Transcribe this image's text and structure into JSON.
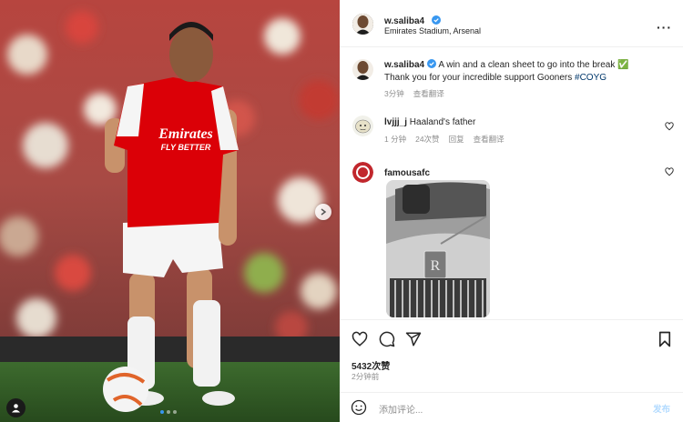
{
  "header": {
    "username": "w.saliba4",
    "location": "Emirates Stadium, Arsenal"
  },
  "caption": {
    "username": "w.saliba4",
    "text_line1": "A win and a clean sheet to go into the break ✅",
    "text_line2": "Thank you for your incredible support Gooners",
    "hashtag": "#COYG",
    "time": "3分钟",
    "translate": "查看翻译"
  },
  "comments": [
    {
      "username": "lvjjj_j",
      "text": "Haaland's father",
      "time": "1 分钟",
      "likes": "24次赞",
      "reply": "回复",
      "translate": "查看翻译"
    },
    {
      "username": "famousafc",
      "image_description": "Rolls-Royce grille"
    }
  ],
  "stats": {
    "likes": "5432次赞",
    "time": "2分钟前"
  },
  "comment_box": {
    "placeholder": "添加评论...",
    "post_label": "发布"
  },
  "photo": {
    "shirt_sponsor_line1": "Emirates",
    "shirt_sponsor_line2": "FLY BETTER"
  },
  "colors": {
    "verified": "#3897f0",
    "hashtag": "#00376b",
    "post_button": "#b3dbff",
    "arsenal_red": "#db0007"
  },
  "icons": [
    "more-icon",
    "heart-icon",
    "comment-icon",
    "share-icon",
    "bookmark-icon",
    "emoji-icon",
    "verified-icon",
    "next-arrow-icon",
    "user-tag-icon"
  ]
}
